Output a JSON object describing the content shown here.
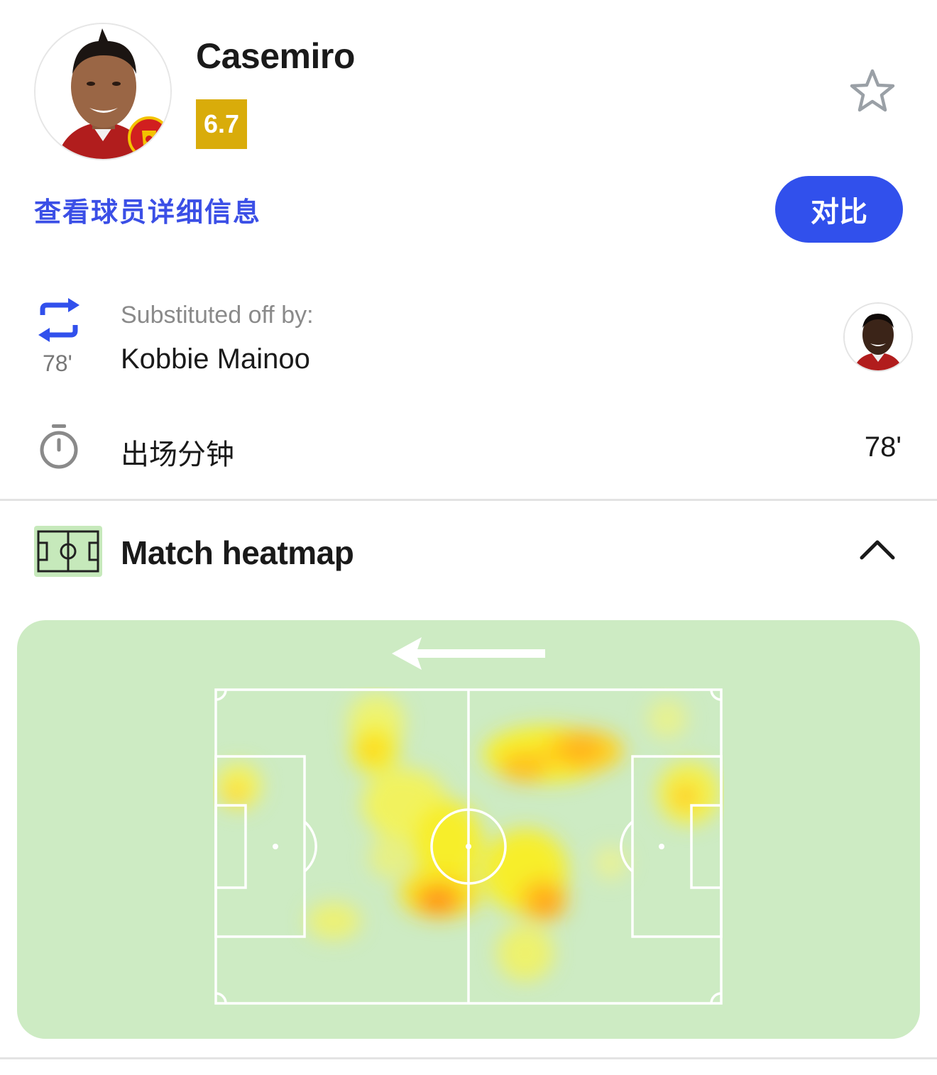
{
  "player": {
    "name": "Casemiro",
    "rating": "6.7",
    "rating_color": "#d9ac0a",
    "club_badge": "manchester-united-crest"
  },
  "actions": {
    "details_link": "查看球员详细信息",
    "compare_label": "对比",
    "favorite_icon": "star-outline-icon"
  },
  "substitution": {
    "label": "Substituted off by:",
    "player": "Kobbie Mainoo",
    "minute": "78'"
  },
  "minutes_played": {
    "label": "出场分钟",
    "value": "78'"
  },
  "heatmap": {
    "title": "Match heatmap",
    "attack_direction": "left",
    "expanded": true
  },
  "colors": {
    "accent": "#3150ec",
    "link": "#3b4fe6",
    "pitch_bg": "#cdebc3"
  }
}
